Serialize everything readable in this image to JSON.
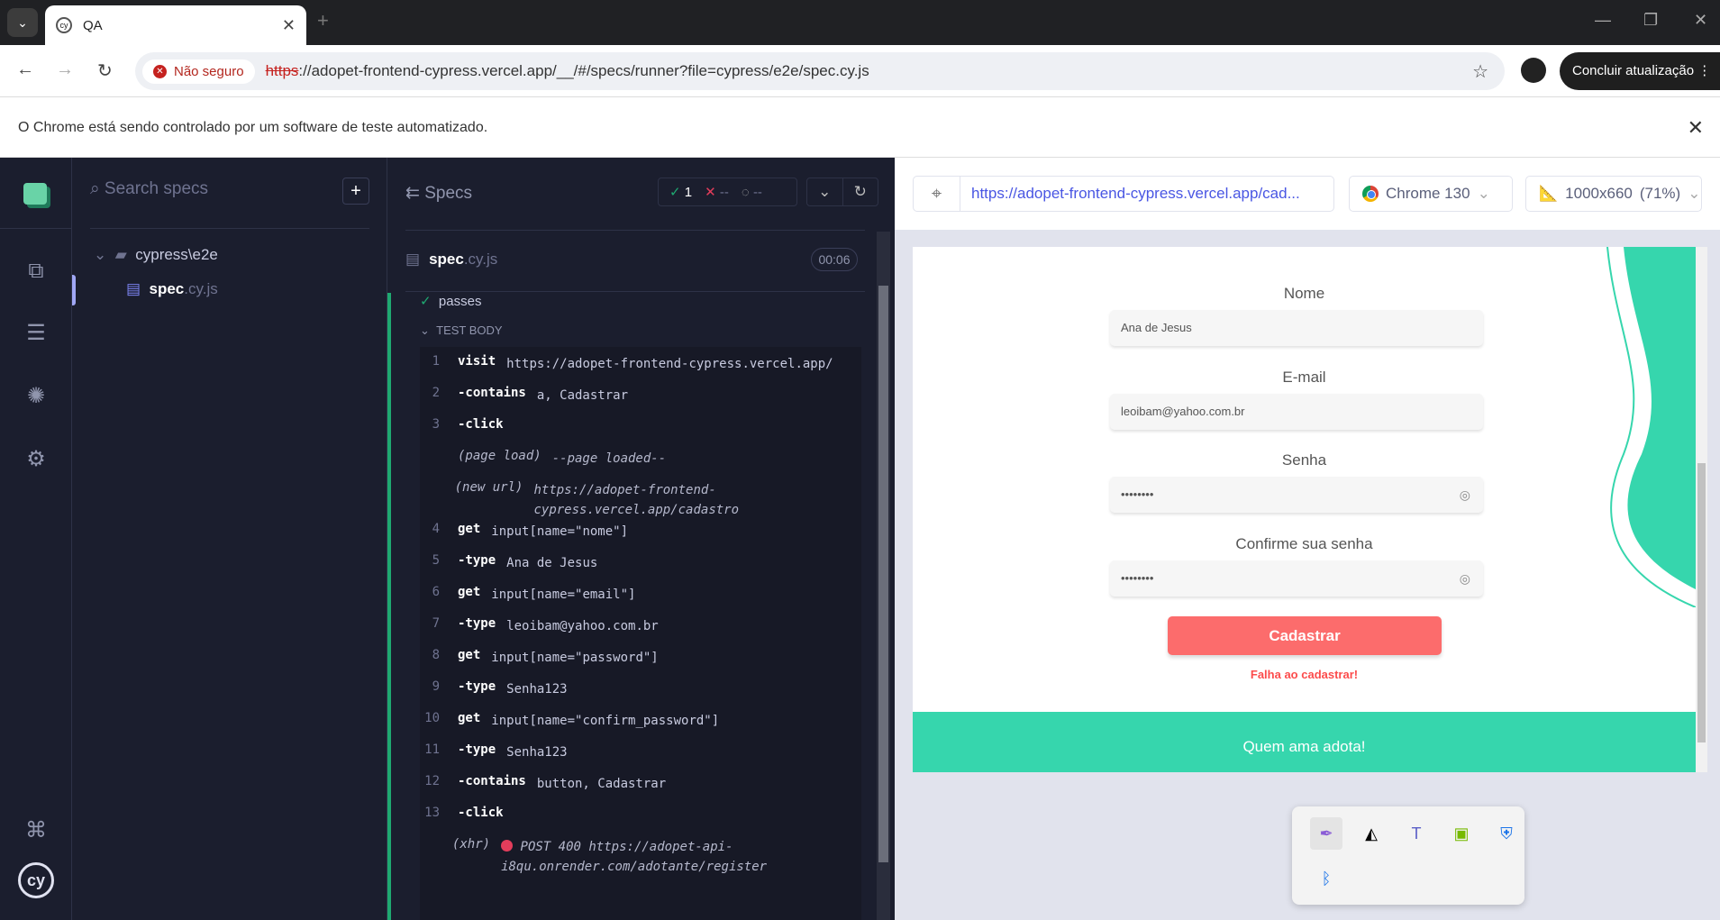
{
  "browser": {
    "tab_title": "QA",
    "insecure_label": "Não seguro",
    "url_scheme": "https",
    "url_rest": "://adopet-frontend-cypress.vercel.app/__/#/specs/runner?file=cypress/e2e/spec.cy.js",
    "update_button": "Concluir atualização",
    "infobar_text": "O Chrome está sendo controlado por um software de teste automatizado."
  },
  "specs_panel": {
    "search_placeholder": "Search specs",
    "folder": "cypress\\e2e",
    "spec_name": "spec",
    "spec_ext": ".cy.js"
  },
  "reporter": {
    "title": "Specs",
    "passed": "1",
    "failed": "--",
    "pending": "--",
    "spec_name": "spec",
    "spec_ext": ".cy.js",
    "duration": "00:06",
    "test_title": "passes",
    "section": "TEST BODY",
    "commands": [
      {
        "n": "1",
        "name": "visit",
        "msg": "https://adopet-frontend-cypress.vercel.app/"
      },
      {
        "n": "2",
        "name": "-contains",
        "msg": "a, Cadastrar"
      },
      {
        "n": "3",
        "name": "-click",
        "msg": ""
      },
      {
        "n": "",
        "name": "(page load)",
        "msg": "--page loaded--",
        "event": true
      },
      {
        "n": "",
        "name": "(new url)",
        "msg": "https://adopet-frontend-cypress.vercel.app/cadastro",
        "event": true
      },
      {
        "n": "4",
        "name": "get",
        "msg": "input[name=\"nome\"]"
      },
      {
        "n": "5",
        "name": "-type",
        "msg": "Ana de Jesus"
      },
      {
        "n": "6",
        "name": "get",
        "msg": "input[name=\"email\"]"
      },
      {
        "n": "7",
        "name": "-type",
        "msg": "leoibam@yahoo.com.br"
      },
      {
        "n": "8",
        "name": "get",
        "msg": "input[name=\"password\"]"
      },
      {
        "n": "9",
        "name": "-type",
        "msg": "Senha123"
      },
      {
        "n": "10",
        "name": "get",
        "msg": "input[name=\"confirm_password\"]"
      },
      {
        "n": "11",
        "name": "-type",
        "msg": "Senha123"
      },
      {
        "n": "12",
        "name": "-contains",
        "msg": "button, Cadastrar"
      },
      {
        "n": "13",
        "name": "-click",
        "msg": ""
      }
    ],
    "xhr": {
      "name": "(xhr)",
      "msg": "POST 400 https://adopet-api-i8qu.onrender.com/adotante/register"
    }
  },
  "aut": {
    "url": "https://adopet-frontend-cypress.vercel.app/cad...",
    "browser": "Chrome 130",
    "viewport": "1000x660",
    "scale": "(71%)"
  },
  "form": {
    "nome_label": "Nome",
    "nome_value": "Ana de Jesus",
    "email_label": "E-mail",
    "email_value": "leoibam@yahoo.com.br",
    "senha_label": "Senha",
    "senha_value": "••••••••",
    "confirm_label": "Confirme sua senha",
    "confirm_value": "••••••••",
    "submit": "Cadastrar",
    "error": "Falha ao cadastrar!",
    "footer": "Quem ama adota!"
  },
  "colors": {
    "accent": "#36d6ad",
    "button": "#fc6c6c",
    "cypress_bg": "#1b1e2e"
  }
}
